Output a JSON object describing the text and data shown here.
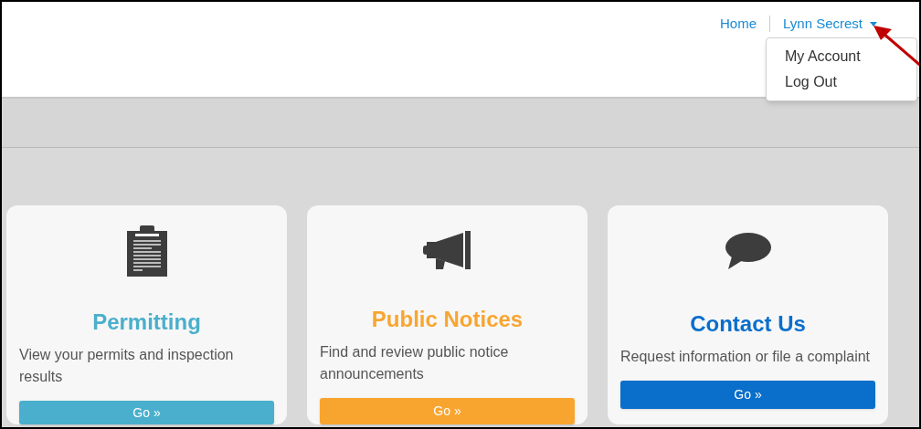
{
  "header": {
    "nav": [
      {
        "label": "Home"
      },
      {
        "label": "Lynn Secrest",
        "expanded": true
      }
    ],
    "menu": [
      {
        "label": "My Account"
      },
      {
        "label": "Log Out"
      }
    ]
  },
  "cards": [
    {
      "kind": "clipboard",
      "title": "Permitting",
      "description": "View your permits and inspection results",
      "button": "Go »",
      "color": "#4aafcc"
    },
    {
      "kind": "megaphone",
      "title": "Public Notices",
      "description": "Find and review public notice announcements",
      "button": "Go »",
      "color": "#f8a530"
    },
    {
      "kind": "chat",
      "title": "Contact Us",
      "description": "Request information or file a complaint",
      "button": "Go »",
      "color": "#0a6ecb"
    }
  ]
}
